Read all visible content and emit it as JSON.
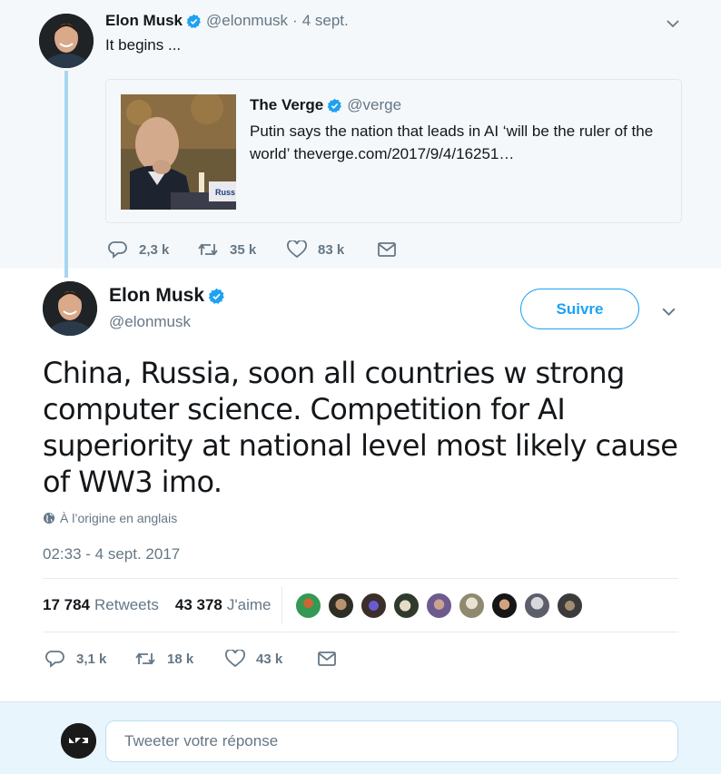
{
  "parent_tweet": {
    "author_name": "Elon Musk",
    "author_handle": "@elonmusk",
    "separator": "·",
    "date": "4 sept.",
    "text": "It begins ...",
    "card": {
      "source_name": "The Verge",
      "source_handle": "@verge",
      "description": "Putin says the nation that leads in AI ‘will be the ruler of the world’ theverge.com/2017/9/4/16251…",
      "image_label": "Russ"
    },
    "actions": {
      "replies": "2,3 k",
      "retweets": "35 k",
      "likes": "83 k"
    }
  },
  "main_tweet": {
    "author_name": "Elon Musk",
    "author_handle": "@elonmusk",
    "follow_label": "Suivre",
    "text": "China, Russia, soon all countries w strong computer science. Competition for AI superiority at national level most likely cause of WW3 imo.",
    "translation_note": "À l’origine en anglais",
    "timestamp": "02:33 - 4 sept. 2017",
    "stats": {
      "retweets_count": "17 784",
      "retweets_label": "Retweets",
      "likes_count": "43 378",
      "likes_label": "J'aime"
    },
    "actions": {
      "replies": "3,1 k",
      "retweets": "18 k",
      "likes": "43 k"
    }
  },
  "reply_box": {
    "placeholder": "Tweeter votre réponse"
  },
  "colors": {
    "accent": "#1da1f2",
    "verified": "#1da1f2",
    "muted_text": "#657786",
    "thread_line": "#a7d6f0"
  },
  "icons": [
    "verified-badge-icon",
    "chevron-down-icon",
    "reply-icon",
    "retweet-icon",
    "like-icon",
    "direct-message-icon",
    "globe-icon"
  ]
}
